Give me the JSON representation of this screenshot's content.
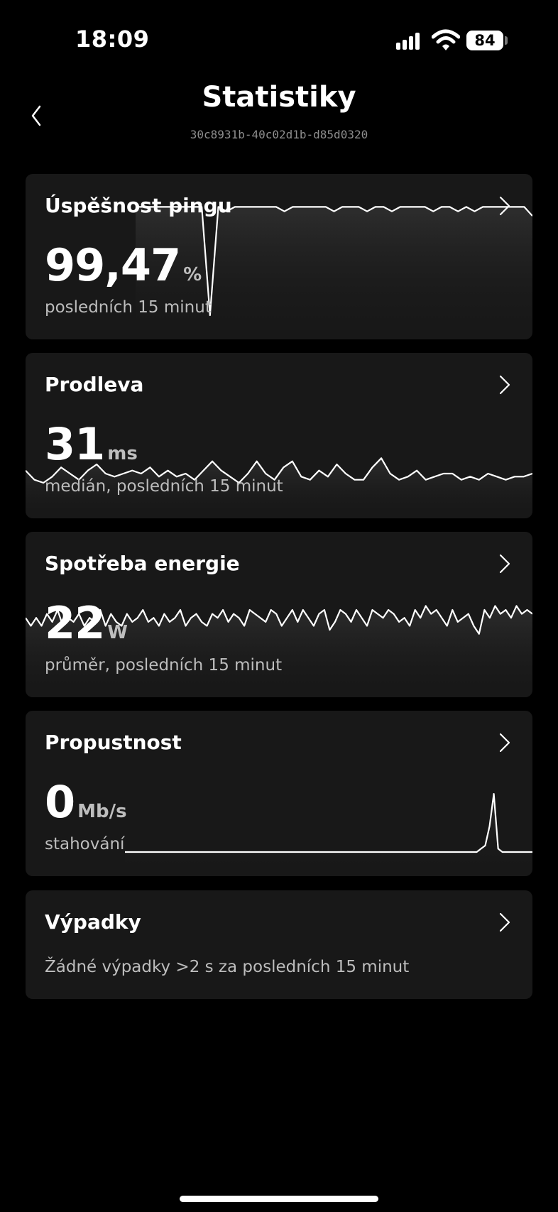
{
  "status": {
    "time": "18:09",
    "battery": "84"
  },
  "header": {
    "title": "Statistiky",
    "subtitle": "30c8931b-40c02d1b-d85d0320"
  },
  "cards": [
    {
      "title": "Úspěšnost pingu",
      "value": "99,47",
      "unit": "%",
      "caption": "posledních 15 minut"
    },
    {
      "title": "Prodleva",
      "value": "31",
      "unit": "ms",
      "caption": "medián, posledních 15 minut"
    },
    {
      "title": "Spotřeba energie",
      "value": "22",
      "unit": "W",
      "caption": "průměr, posledních 15 minut"
    },
    {
      "title": "Propustnost",
      "value": "0",
      "unit": "Mb/s",
      "caption": "stahování"
    },
    {
      "title": "Výpadky",
      "caption": "Žádné výpadky >2 s za posledních 15 minut"
    }
  ],
  "icons": {
    "back": "chevron-left-icon",
    "chevron": "chevron-right-icon",
    "signal": "cellular-signal-icon",
    "wifi": "wifi-icon",
    "battery": "battery-icon"
  },
  "colors": {
    "background": "#000000",
    "card": "#181818",
    "line": "#ffffff",
    "caption": "#bdbdbd"
  },
  "chart_data": [
    {
      "type": "line",
      "series": [
        {
          "values": [
            99.9,
            99.9,
            99.9,
            99.9,
            99.9,
            99.9,
            99.9,
            99.9,
            99.9,
            97.5,
            99.9,
            99.8,
            99.9,
            99.9,
            99.9,
            99.9,
            99.9,
            99.9,
            99.8,
            99.9,
            99.9,
            99.9,
            99.9,
            99.9,
            99.8,
            99.9,
            99.9,
            99.9,
            99.8,
            99.9,
            99.9,
            99.8,
            99.9,
            99.9,
            99.9,
            99.9,
            99.8,
            99.9,
            99.9,
            99.8,
            99.9,
            99.8,
            99.9,
            99.9,
            99.9,
            99.9,
            99.9,
            99.9,
            99.7
          ]
        }
      ],
      "ylim": [
        95,
        100
      ]
    },
    {
      "type": "line",
      "series": [
        {
          "values": [
            31,
            28,
            27,
            29,
            32,
            30,
            28,
            31,
            33,
            30,
            29,
            30,
            31,
            30,
            32,
            29,
            31,
            29,
            30,
            28,
            31,
            34,
            31,
            29,
            27,
            30,
            34,
            30,
            28,
            32,
            34,
            29,
            28,
            31,
            29,
            33,
            30,
            28,
            28,
            32,
            35,
            30,
            28,
            29,
            31,
            28,
            29,
            30,
            30,
            28,
            29,
            28,
            30,
            29,
            28,
            29,
            29,
            30
          ]
        }
      ],
      "ylim": [
        0,
        60
      ]
    },
    {
      "type": "line",
      "series": [
        {
          "values": [
            22,
            20,
            22,
            20,
            23,
            21,
            24,
            20,
            22,
            21,
            23,
            20,
            22,
            21,
            24,
            20,
            23,
            21,
            20,
            23,
            21,
            22,
            24,
            21,
            22,
            20,
            23,
            21,
            22,
            24,
            20,
            22,
            23,
            21,
            20,
            23,
            22,
            24,
            21,
            23,
            22,
            20,
            24,
            23,
            22,
            21,
            24,
            23,
            20,
            22,
            24,
            21,
            24,
            22,
            20,
            23,
            24,
            19,
            21,
            24,
            23,
            21,
            24,
            22,
            20,
            24,
            23,
            22,
            24,
            23,
            21,
            22,
            20,
            24,
            22,
            25,
            23,
            24,
            22,
            20,
            24,
            21,
            22,
            23,
            20,
            18,
            24,
            22,
            25,
            23,
            24,
            22,
            25,
            23,
            24,
            23
          ]
        }
      ],
      "ylim": [
        0,
        40
      ]
    },
    {
      "type": "line",
      "series": [
        {
          "values": [
            0,
            0,
            0,
            0,
            0,
            0,
            0,
            0,
            0,
            0,
            0,
            0,
            0,
            0,
            0,
            0,
            0,
            0,
            0,
            0,
            0,
            0,
            0,
            0,
            0,
            0,
            0,
            0,
            0,
            0,
            0,
            0,
            0,
            0,
            0,
            0,
            0,
            0,
            0,
            0,
            0,
            0,
            0,
            0,
            0,
            0,
            0,
            0,
            0,
            0,
            0,
            0,
            0,
            0,
            0,
            0,
            0,
            0,
            0,
            0,
            0,
            0,
            0,
            0,
            0,
            0,
            0,
            0,
            0,
            0,
            0,
            0,
            0,
            0,
            0,
            0,
            0,
            0,
            0,
            0,
            0,
            0,
            0,
            0.5,
            1,
            4,
            9,
            0.5,
            0,
            0,
            0,
            0,
            0,
            0,
            0,
            0
          ]
        }
      ],
      "ylim": [
        0,
        10
      ]
    }
  ]
}
